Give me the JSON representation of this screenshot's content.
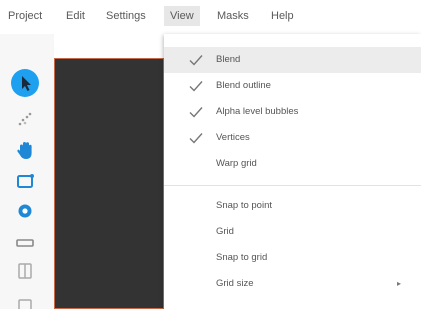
{
  "menubar": {
    "items": [
      {
        "label": "Project"
      },
      {
        "label": "Edit"
      },
      {
        "label": "Settings"
      },
      {
        "label": "View"
      },
      {
        "label": "Masks"
      },
      {
        "label": "Help"
      }
    ],
    "active": "View"
  },
  "toolbar": {
    "tools": [
      {
        "icon": "pointer-icon",
        "active": true
      },
      {
        "icon": "scatter-points-icon"
      },
      {
        "icon": "hand-icon"
      },
      {
        "icon": "crop-frame-icon"
      },
      {
        "icon": "circle-target-icon"
      },
      {
        "icon": "horizontal-bar-icon"
      },
      {
        "icon": "split-panel-icon"
      }
    ],
    "accent": "#1ea0f0"
  },
  "view_menu": {
    "items": [
      {
        "label": "Blend",
        "checked": true,
        "highlighted": true
      },
      {
        "label": "Blend outline",
        "checked": true
      },
      {
        "label": "Alpha level bubbles",
        "checked": true
      },
      {
        "label": "Vertices",
        "checked": true
      },
      {
        "label": "Warp grid",
        "checked": false
      },
      {
        "label": "Snap to point",
        "checked": false
      },
      {
        "label": "Grid",
        "checked": false
      },
      {
        "label": "Snap to grid",
        "checked": false
      },
      {
        "label": "Grid size",
        "checked": false,
        "submenu": true,
        "arrow": "▸"
      }
    ]
  },
  "colors": {
    "canvas": "#333333",
    "canvas_border": "#c46a4a",
    "highlight": "#ececec"
  }
}
